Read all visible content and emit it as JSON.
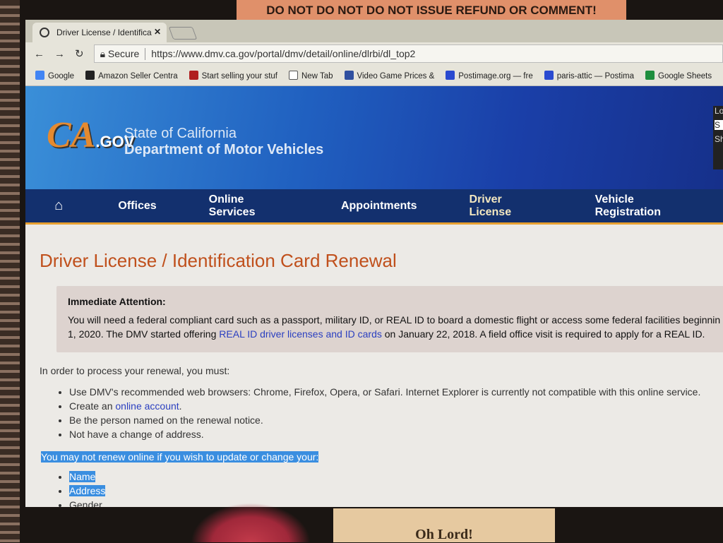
{
  "sticky_notes": {
    "top": "DO NOT DO NOT DO NOT ISSUE REFUND OR COMMENT!",
    "bottom": "Oh Lord!"
  },
  "browser": {
    "tab_title": "Driver License / Identifica",
    "secure_label": "Secure",
    "url": "https://www.dmv.ca.gov/portal/dmv/detail/online/dlrbi/dl_top2",
    "bookmarks": [
      {
        "label": "Google",
        "icon": "google-icon",
        "color": "#4285f4"
      },
      {
        "label": "Amazon Seller Centra",
        "icon": "amazon-icon",
        "color": "#222222"
      },
      {
        "label": "Start selling your stuf",
        "icon": "shopping-bag-icon",
        "color": "#b02020"
      },
      {
        "label": "New Tab",
        "icon": "page-icon",
        "color": "#ffffff"
      },
      {
        "label": "Video Game Prices &",
        "icon": "controller-icon",
        "color": "#3050a0"
      },
      {
        "label": "Postimage.org — fre",
        "icon": "postimage-icon",
        "color": "#2a4ad0"
      },
      {
        "label": "paris-attic — Postima",
        "icon": "postimage-icon",
        "color": "#2a4ad0"
      },
      {
        "label": "Google Sheets",
        "icon": "sheets-icon",
        "color": "#1e8e3e"
      }
    ]
  },
  "site": {
    "logo": "CA.GOV",
    "agency_line1": "State of California",
    "agency_line2": "Department of Motor Vehicles",
    "side_fragments": [
      "Lo",
      "S",
      "Sh"
    ],
    "nav": [
      "Offices",
      "Online Services",
      "Appointments",
      "Driver License",
      "Vehicle Registration"
    ],
    "active_nav": "Driver License"
  },
  "page": {
    "title": "Driver License / Identification Card Renewal",
    "alert_heading": "Immediate Attention:",
    "alert_line1": "You will need a federal compliant card such as a passport, military ID, or REAL ID to board a domestic flight or access some federal facilities beginnin",
    "alert_line2_pre": "1, 2020. The DMV started offering ",
    "alert_link": "REAL ID driver licenses and ID cards",
    "alert_line2_post": " on January 22, 2018. A field office visit is required to apply for a REAL ID.",
    "intro": "In order to process your renewal, you must:",
    "req1": "Use DMV's recommended web browsers: Chrome, Firefox, Opera, or Safari. Internet Explorer is currently not compatible with this online service.",
    "req2_pre": "Create an ",
    "req2_link": "online account",
    "req2_post": ".",
    "req3": "Be the person named on the renewal notice.",
    "req4": "Not have a change of address.",
    "warning": "You may not renew online if you wish to update or change your:",
    "changes": [
      "Name",
      "Address",
      "Gender"
    ]
  }
}
